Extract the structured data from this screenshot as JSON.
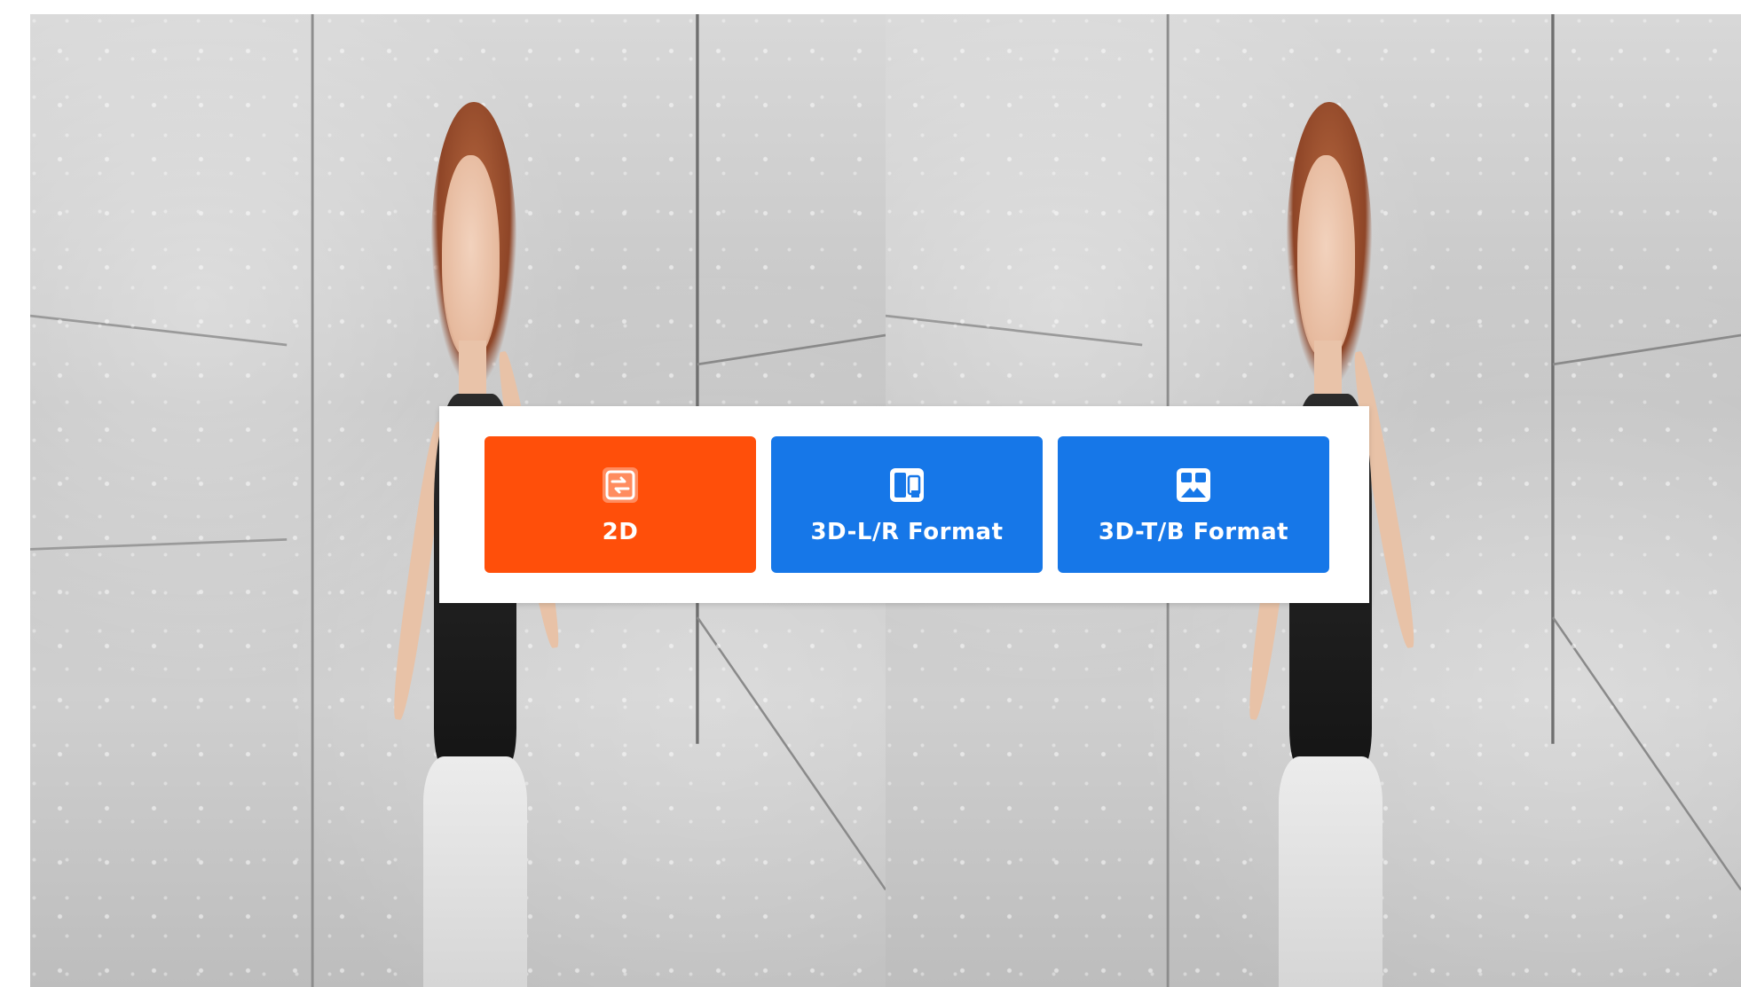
{
  "viewer": {
    "mode_selector": {
      "options": [
        {
          "label": "2D",
          "icon": "2d-mode-icon",
          "selected": true
        },
        {
          "label": "3D-L/R Format",
          "icon": "side-by-side-icon",
          "selected": false
        },
        {
          "label": "3D-T/B Format",
          "icon": "top-bottom-icon",
          "selected": false
        }
      ]
    }
  },
  "colors": {
    "selected_option": "#ff4f0a",
    "unselected_option": "#1677e8",
    "dialog_background": "#ffffff"
  }
}
